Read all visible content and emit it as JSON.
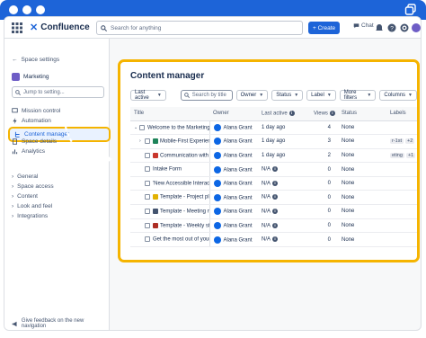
{
  "nav": {
    "app_name": "Confluence",
    "search_placeholder": "Search for anything",
    "create_label": "+ Create",
    "chat_label": "Chat"
  },
  "sidebar": {
    "back_label": "Space settings",
    "space_name": "Marketing",
    "jump_placeholder": "Jump to setting...",
    "items": [
      {
        "label": "Mission control"
      },
      {
        "label": "Automation"
      },
      {
        "label": "Content manager",
        "active": true
      },
      {
        "label": "Space details"
      },
      {
        "label": "Analytics"
      }
    ],
    "groups": [
      {
        "label": "General"
      },
      {
        "label": "Space access"
      },
      {
        "label": "Content"
      },
      {
        "label": "Look and feel"
      },
      {
        "label": "Integrations"
      }
    ],
    "footer": "Give feedback on the new navigation"
  },
  "panel": {
    "title": "Content manager",
    "filters": {
      "last_active": "Last active",
      "search_placeholder": "Search by title",
      "owner": "Owner",
      "status": "Status",
      "label": "Label",
      "more_filters": "More filters",
      "columns": "Columns"
    },
    "columns": [
      "Title",
      "Owner",
      "Last active",
      "Views",
      "Status",
      "Labels"
    ],
    "rows": [
      {
        "title": "Welcome to the Marketing",
        "owner": "Alana Grant",
        "last_active": "1 day ago",
        "views": "4",
        "status": "None",
        "labels": [],
        "expander": "v",
        "icon_color": ""
      },
      {
        "title": "Mobile-First Experienc",
        "owner": "Alana Grant",
        "last_active": "1 day ago",
        "views": "3",
        "status": "None",
        "labels": [
          "r-1st",
          "+2"
        ],
        "expander": ">",
        "icon_color": "#1f845a"
      },
      {
        "title": "Communication with th",
        "owner": "Alana Grant",
        "last_active": "1 day ago",
        "views": "2",
        "status": "None",
        "labels": [
          "eting",
          "+1"
        ],
        "expander": "",
        "icon_color": "#c9372c"
      },
      {
        "title": "Intake Form",
        "owner": "Alana Grant",
        "last_active": "N/A",
        "views": "0",
        "status": "None",
        "labels": [],
        "expander": "",
        "icon_color": ""
      },
      {
        "title": "'New Accessible Interacti",
        "owner": "Alana Grant",
        "last_active": "N/A",
        "views": "0",
        "status": "None",
        "labels": [],
        "expander": "",
        "icon_color": ""
      },
      {
        "title": "Template - Project plar",
        "owner": "Alana Grant",
        "last_active": "N/A",
        "views": "0",
        "status": "None",
        "labels": [],
        "expander": "",
        "icon_color": "#e2b203"
      },
      {
        "title": "Template - Meeting no",
        "owner": "Alana Grant",
        "last_active": "N/A",
        "views": "0",
        "status": "None",
        "labels": [],
        "expander": "",
        "icon_color": "#44546f"
      },
      {
        "title": "Template - Weekly stat",
        "owner": "Alana Grant",
        "last_active": "N/A",
        "views": "0",
        "status": "None",
        "labels": [],
        "expander": "",
        "icon_color": "#ae2e24"
      },
      {
        "title": "Get the most out of your",
        "owner": "Alana Grant",
        "last_active": "N/A",
        "views": "0",
        "status": "None",
        "labels": [],
        "expander": "",
        "icon_color": ""
      }
    ]
  },
  "colors": {
    "brand": "#1d64d8",
    "highlight": "#f5b400"
  }
}
